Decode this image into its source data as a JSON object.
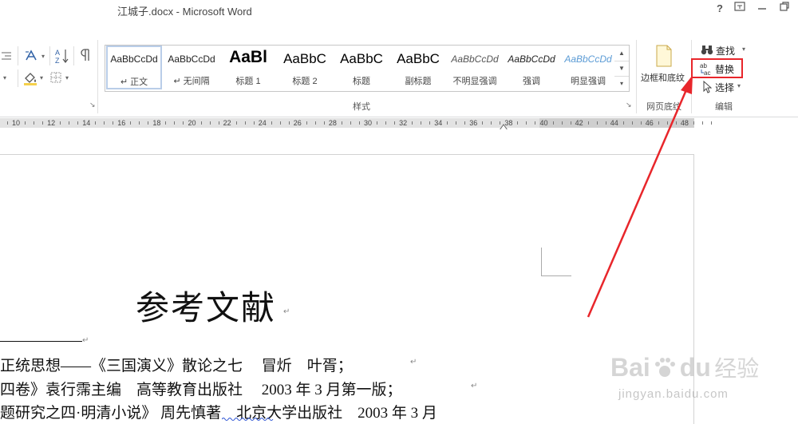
{
  "window": {
    "title": "江城子.docx - Microsoft Word",
    "help_icon": "?",
    "restore_ribbon_icon": "restore-ribbon-icon",
    "minimize_icon": "minimize-icon",
    "maximize_icon": "maximize-icon"
  },
  "ribbon": {
    "styles_group_label": "样式",
    "styles": [
      {
        "sample": "AaBbCcDd",
        "name": "↵ 正文",
        "selected": true
      },
      {
        "sample": "AaBbCcDd",
        "name": "↵ 无间隔"
      },
      {
        "sample": "AaBl",
        "name": "标题 1"
      },
      {
        "sample": "AaBbC",
        "name": "标题 2"
      },
      {
        "sample": "AaBbC",
        "name": "标题"
      },
      {
        "sample": "AaBbC",
        "name": "副标题"
      },
      {
        "sample": "AaBbCcDd",
        "name": "不明显强调"
      },
      {
        "sample": "AaBbCcDd",
        "name": "强调"
      },
      {
        "sample": "AaBbCcDd",
        "name": "明显强调"
      }
    ],
    "page_bg_button": "边框和底纹",
    "page_bg_group_label": "网页底纹",
    "editing": {
      "find_label": "查找",
      "replace_label": "替换",
      "select_label": "选择",
      "group_label": "编辑"
    },
    "accent_color": "#e8262b"
  },
  "ruler": {
    "numbers": [
      "10",
      "12",
      "14",
      "16",
      "18",
      "20",
      "22",
      "24",
      "26",
      "28",
      "30",
      "32",
      "34",
      "36",
      "38",
      "40",
      "42",
      "44",
      "46",
      "48"
    ]
  },
  "document": {
    "heading": "参考文献",
    "lines": [
      "正统思想——《三国演义》散论之七　 冒炘　叶胥；",
      "四卷》袁行霈主编　高等教育出版社　 2003 年 3 月第一版；",
      "题研究之四·明清小说》 周先慎著　北京大学出版社　2003 年 3 月"
    ]
  },
  "watermark": {
    "brand": "Bai",
    "brand2": "du",
    "suffix": "经验",
    "url": "jingyan.baidu.com"
  }
}
